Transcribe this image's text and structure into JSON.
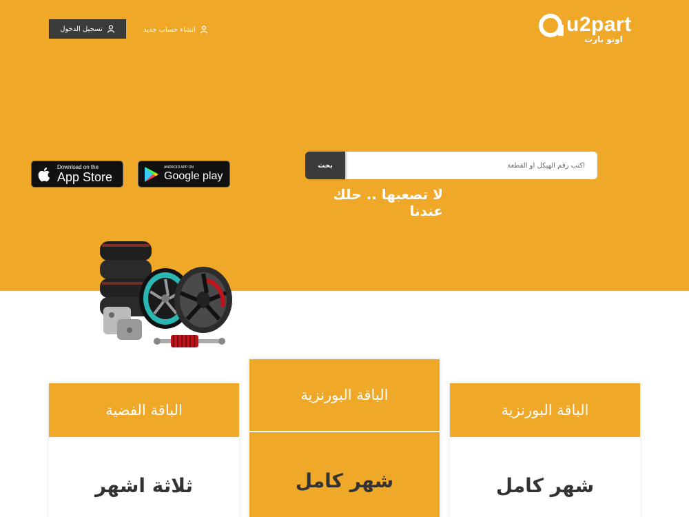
{
  "header": {
    "login_label": "تسجيل الدخول",
    "register_label": "انشاء حساب جديد",
    "logo_text": "u2part",
    "logo_subtext": "اوتو بارت"
  },
  "apps": {
    "apple_small": "Download on the",
    "apple_big": "App Store",
    "google_small": "ANDROID APP ON",
    "google_big": "Google play"
  },
  "search": {
    "placeholder": "اكتب رقم الهيكل او القطعة",
    "button_label": "بحث"
  },
  "tagline": "لا تصعبها .. حلك عندنا",
  "plans": [
    {
      "title": "الباقة الفضية",
      "duration": "ثلاثة اشهر"
    },
    {
      "title": "الباقة البورنزية",
      "duration": "شهر كامل"
    },
    {
      "title": "الباقة البورنزية",
      "duration": "شهر كامل"
    }
  ],
  "colors": {
    "accent": "#efa828",
    "dark": "#3b3b3b"
  }
}
